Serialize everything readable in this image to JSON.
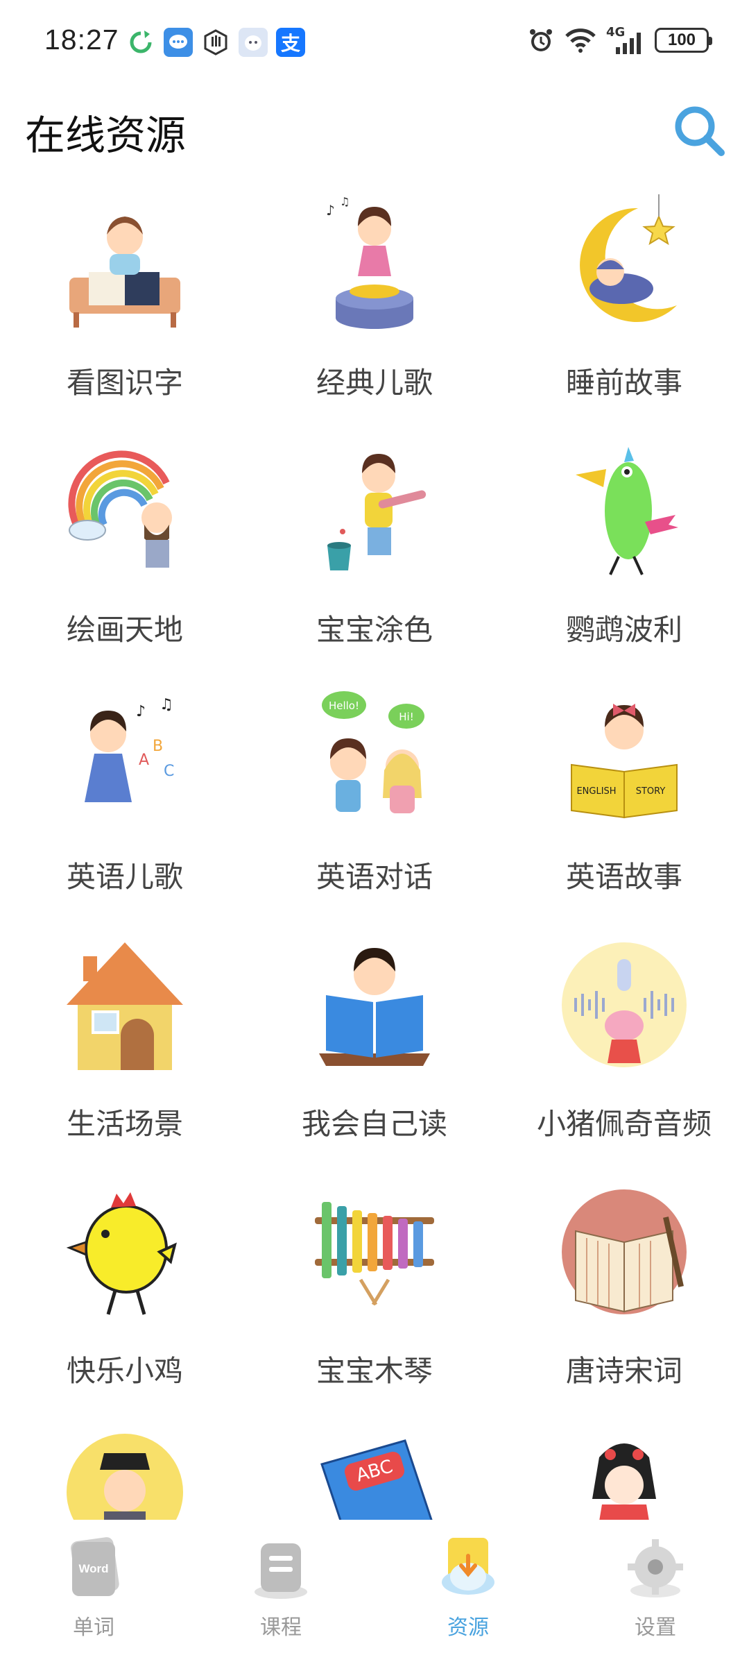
{
  "status_bar": {
    "time": "18:27",
    "notification_icons": [
      "sync-icon",
      "message-icon",
      "hand-icon",
      "ghost-app-icon",
      "alipay-icon"
    ],
    "alipay_glyph": "支",
    "network": "4G",
    "battery": "100"
  },
  "header": {
    "title": "在线资源"
  },
  "resources": [
    {
      "label": "看图识字",
      "icon": "picture-literacy-icon"
    },
    {
      "label": "经典儿歌",
      "icon": "classic-songs-icon"
    },
    {
      "label": "睡前故事",
      "icon": "bedtime-story-icon"
    },
    {
      "label": "绘画天地",
      "icon": "painting-world-icon"
    },
    {
      "label": "宝宝涂色",
      "icon": "baby-coloring-icon"
    },
    {
      "label": "鹦鹉波利",
      "icon": "parrot-poly-icon"
    },
    {
      "label": "英语儿歌",
      "icon": "english-songs-icon"
    },
    {
      "label": "英语对话",
      "icon": "english-dialogue-icon"
    },
    {
      "label": "英语故事",
      "icon": "english-story-icon"
    },
    {
      "label": "生活场景",
      "icon": "life-scenes-icon"
    },
    {
      "label": "我会自己读",
      "icon": "self-reading-icon"
    },
    {
      "label": "小猪佩奇音频",
      "icon": "peppa-audio-icon"
    },
    {
      "label": "快乐小鸡",
      "icon": "happy-chick-icon"
    },
    {
      "label": "宝宝木琴",
      "icon": "baby-xylophone-icon"
    },
    {
      "label": "唐诗宋词",
      "icon": "tang-poetry-icon"
    }
  ],
  "partial_row_icons": [
    "scholar-icon",
    "abc-book-icon",
    "opera-girl-icon"
  ],
  "illustration_text": {
    "hello": "Hello!",
    "hi": "Hi!",
    "english": "ENGLISH",
    "story": "STORY",
    "abc": "ABC",
    "word": "Word"
  },
  "bottom_nav": [
    {
      "label": "单词",
      "icon": "word-card-icon",
      "active": false
    },
    {
      "label": "课程",
      "icon": "course-icon",
      "active": false
    },
    {
      "label": "资源",
      "icon": "resource-download-icon",
      "active": true
    },
    {
      "label": "设置",
      "icon": "settings-gear-icon",
      "active": false
    }
  ],
  "colors": {
    "accent": "#4aa3df",
    "title": "#111111",
    "label": "#444444",
    "nav_inactive": "#999999"
  }
}
